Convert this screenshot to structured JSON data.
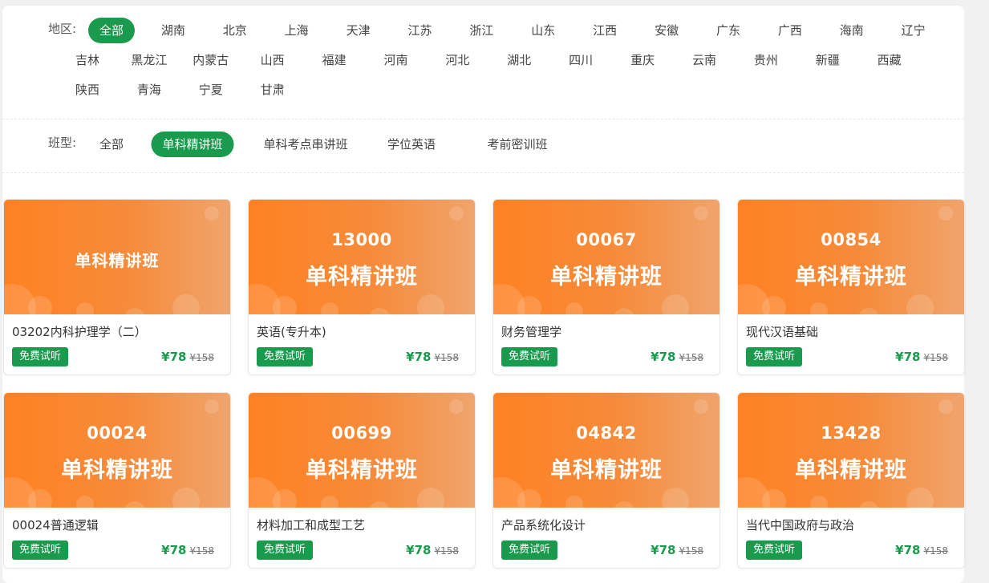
{
  "region_filter": {
    "label": "地区:",
    "selected": "全部",
    "options": [
      "全部",
      "湖南",
      "北京",
      "上海",
      "天津",
      "江苏",
      "浙江",
      "山东",
      "江西",
      "安徽",
      "广东",
      "广西",
      "海南",
      "辽宁",
      "吉林",
      "黑龙江",
      "内蒙古",
      "山西",
      "福建",
      "河南",
      "河北",
      "湖北",
      "四川",
      "重庆",
      "云南",
      "贵州",
      "新疆",
      "西藏",
      "陕西",
      "青海",
      "宁夏",
      "甘肃"
    ]
  },
  "class_filter": {
    "label": "班型:",
    "selected": "单科精讲班",
    "options": [
      "全部",
      "单科精讲班",
      "单科考点串讲班",
      "学位英语",
      "考前密训班"
    ]
  },
  "courses": [
    {
      "code": "",
      "type": "单科精讲班",
      "name": "03202内科护理学（二）",
      "trial": "免费试听",
      "price": "¥78",
      "original_price": "¥158"
    },
    {
      "code": "13000",
      "type": "单科精讲班",
      "name": "英语(专升本)",
      "trial": "免费试听",
      "price": "¥78",
      "original_price": "¥158"
    },
    {
      "code": "00067",
      "type": "单科精讲班",
      "name": "财务管理学",
      "trial": "免费试听",
      "price": "¥78",
      "original_price": "¥158"
    },
    {
      "code": "00854",
      "type": "单科精讲班",
      "name": "现代汉语基础",
      "trial": "免费试听",
      "price": "¥78",
      "original_price": "¥158"
    },
    {
      "code": "00024",
      "type": "单科精讲班",
      "name": "00024普通逻辑",
      "trial": "免费试听",
      "price": "¥78",
      "original_price": "¥158"
    },
    {
      "code": "00699",
      "type": "单科精讲班",
      "name": "材料加工和成型工艺",
      "trial": "免费试听",
      "price": "¥78",
      "original_price": "¥158"
    },
    {
      "code": "04842",
      "type": "单科精讲班",
      "name": "产品系统化设计",
      "trial": "免费试听",
      "price": "¥78",
      "original_price": "¥158"
    },
    {
      "code": "13428",
      "type": "单科精讲班",
      "name": "当代中国政府与政治",
      "trial": "免费试听",
      "price": "¥78",
      "original_price": "¥158"
    }
  ],
  "colors": {
    "accent_green": "#1a9a4d",
    "banner_orange": "#ff8123"
  }
}
